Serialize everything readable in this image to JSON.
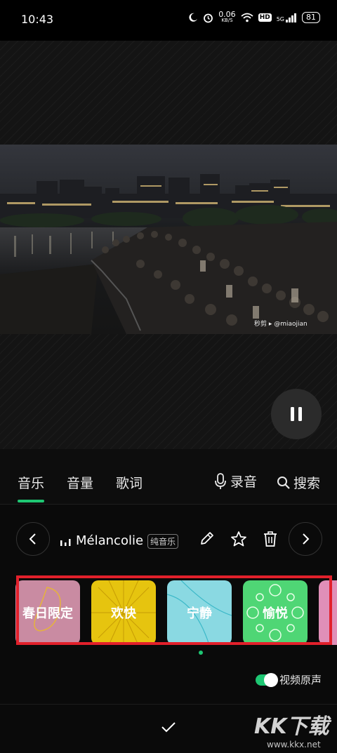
{
  "status_bar": {
    "time": "10:43",
    "net_speed_value": "0.06",
    "net_speed_unit": "KB/S",
    "hd_label": "HD",
    "signal_label": "5G",
    "battery": "81",
    "icons": [
      "moon-icon",
      "alarm-icon",
      "wifi-icon",
      "hd-icon",
      "signal-icon",
      "battery-icon"
    ]
  },
  "video": {
    "watermark": "秒剪 ▸ @miaojian"
  },
  "tabs": {
    "music": "音乐",
    "volume": "音量",
    "lyrics": "歌词",
    "record": "录音",
    "search": "搜索",
    "active": "music"
  },
  "track": {
    "name": "Mélancolie",
    "badge": "纯音乐"
  },
  "styles": [
    {
      "label": "春日限定",
      "color": "#c98ba2"
    },
    {
      "label": "欢快",
      "color": "#e6c40f"
    },
    {
      "label": "宁静",
      "color": "#8ad9e2"
    },
    {
      "label": "愉悦",
      "color": "#4fd675"
    },
    {
      "label": "",
      "color": "#e08fb8"
    }
  ],
  "video_original_sound": {
    "label": "视频原声",
    "enabled": true
  },
  "site_watermark": {
    "big": "KK下载",
    "small": "www.kkx.net"
  },
  "colors": {
    "accent": "#1ec773",
    "highlight": "#e2202b"
  }
}
